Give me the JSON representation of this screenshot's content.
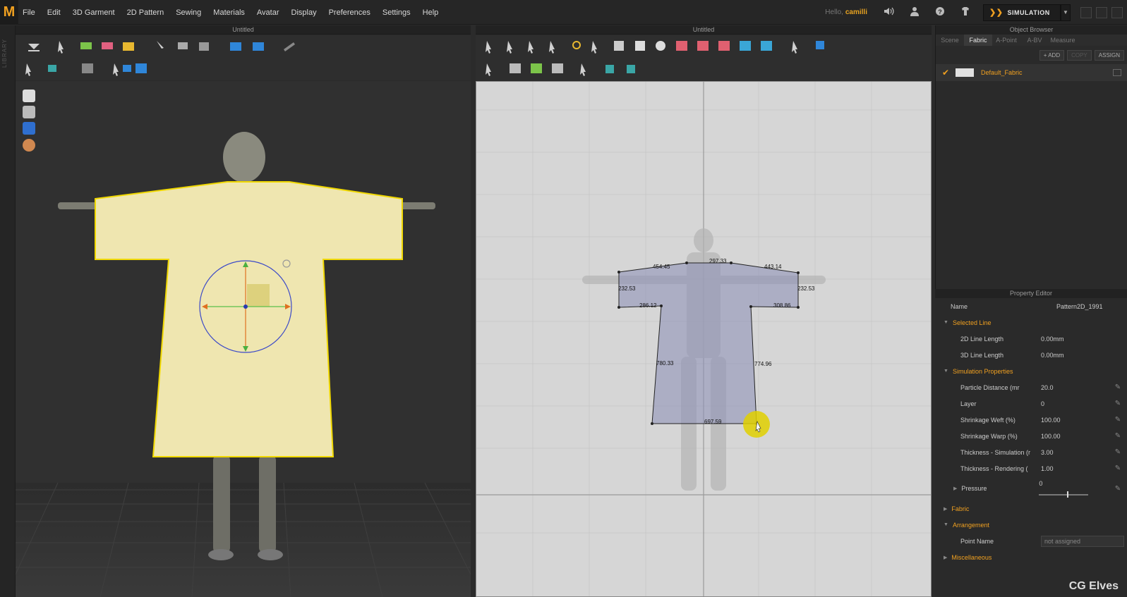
{
  "app": {
    "logo": "M",
    "menu": [
      "File",
      "Edit",
      "3D Garment",
      "2D Pattern",
      "Sewing",
      "Materials",
      "Avatar",
      "Display",
      "Preferences",
      "Settings",
      "Help"
    ],
    "hello": "Hello,",
    "username": "camilli",
    "mode_button": "SIMULATION"
  },
  "library_label": "LIBRARY",
  "window_3d": {
    "title": "Untitled"
  },
  "window_2d": {
    "title": "Untitled",
    "measurements": [
      "454.45",
      "297.33",
      "443.14",
      "232.53",
      "232.53",
      "286.12",
      "308.86",
      "780.33",
      "774.96",
      "697.59"
    ]
  },
  "object_browser": {
    "title": "Object Browser",
    "tabs": [
      "Scene",
      "Fabric",
      "A-Point",
      "A-BV",
      "Measure"
    ],
    "active_tab": "Fabric",
    "actions": {
      "add": "+ ADD",
      "copy": "COPY",
      "assign": "ASSIGN"
    },
    "fabric_name": "Default_Fabric"
  },
  "property_editor": {
    "title": "Property Editor",
    "name_label": "Name",
    "name_value": "Pattern2D_1991",
    "selected_line": "Selected Line",
    "line2d_label": "2D Line Length",
    "line2d_value": "0.00mm",
    "line3d_label": "3D Line Length",
    "line3d_value": "0.00mm",
    "sim_props": "Simulation Properties",
    "particle_label": "Particle Distance (mr",
    "particle_value": "20.0",
    "layer_label": "Layer",
    "layer_value": "0",
    "weft_label": "Shrinkage Weft (%)",
    "weft_value": "100.00",
    "warp_label": "Shrinkage Warp (%)",
    "warp_value": "100.00",
    "thick_sim_label": "Thickness - Simulation (r",
    "thick_sim_value": "3.00",
    "thick_ren_label": "Thickness - Rendering (",
    "thick_ren_value": "1.00",
    "pressure_label": "Pressure",
    "pressure_value": "0",
    "fabric": "Fabric",
    "arrangement": "Arrangement",
    "point_name_label": "Point Name",
    "point_name_value": "not assigned",
    "misc": "Miscellaneous"
  },
  "watermark": "CG Elves"
}
